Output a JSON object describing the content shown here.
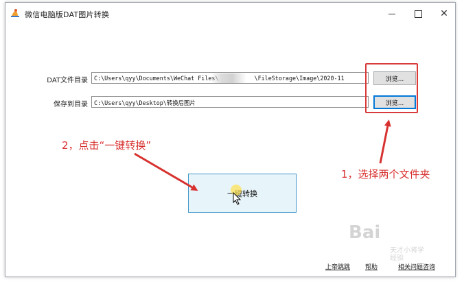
{
  "window": {
    "title": "微信电脑版DAT图片转换"
  },
  "form": {
    "dat_dir_label": "DAT文件目录",
    "dat_dir_value_start": "C:\\Users\\qyy\\Documents\\WeChat Files\\",
    "dat_dir_value_end": "\\FileStorage\\Image\\2020-11",
    "save_dir_label": "保存到目录",
    "save_dir_value": "C:\\Users\\qyy\\Desktop\\转换后图片",
    "browse_label": "浏览..."
  },
  "convert_button": {
    "label": "一键转换"
  },
  "annotations": {
    "step2": "2，点击“一键转换”",
    "step1": "1，选择两个文件夹",
    "color": "#d7322f"
  },
  "footer": {
    "link1": "上帝跳跳",
    "link2": "帮助",
    "link3": "相关问题咨询"
  },
  "watermark": {
    "brand": "Bai",
    "sub": "天才小将学\n经验"
  },
  "icons": {
    "app": "app-logo-icon",
    "minimize": "minimize-icon",
    "maximize": "maximize-icon",
    "close": "close-icon",
    "cursor": "hand-cursor-icon"
  }
}
